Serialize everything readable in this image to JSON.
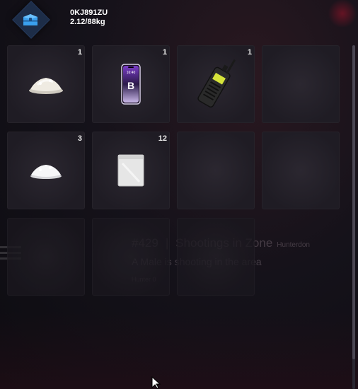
{
  "header": {
    "plate": "0KJ891ZU",
    "weight": "2.12/88kg",
    "icon": "storage-box-icon"
  },
  "background": {
    "notification": {
      "code": "#429",
      "separator": "|",
      "title": "Shootings in Zone",
      "title_suffix": "Hunterdon",
      "message": "A Male is shooting in the area",
      "meta": "Hunter 0"
    }
  },
  "slots": [
    {
      "item": "powder-pile",
      "qty": "1"
    },
    {
      "item": "smartphone",
      "qty": "1"
    },
    {
      "item": "walkie-talkie",
      "qty": "1"
    },
    {
      "item": null,
      "qty": ""
    },
    {
      "item": "powder-pile",
      "qty": "3"
    },
    {
      "item": "white-bag",
      "qty": "12"
    },
    {
      "item": null,
      "qty": ""
    },
    {
      "item": null,
      "qty": ""
    },
    {
      "item": null,
      "qty": ""
    },
    {
      "item": null,
      "qty": ""
    },
    {
      "item": null,
      "qty": ""
    }
  ],
  "phone_screen": {
    "time": "16:40",
    "logo": "B"
  }
}
